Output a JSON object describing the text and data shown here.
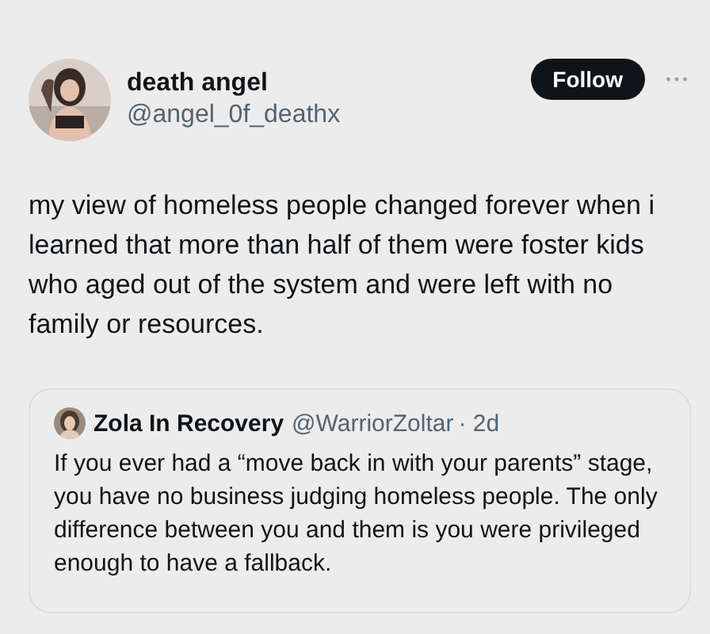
{
  "post": {
    "author": {
      "name": "death angel",
      "handle": "@angel_0f_deathx"
    },
    "follow_button": "Follow",
    "text": "my view of homeless people changed forever when i learned that more than half of them were foster kids who aged out of the system and were left with no family or resources.",
    "quoted_post": {
      "author": {
        "name": "Zola In Recovery",
        "handle": "@WarriorZoltar"
      },
      "time": "· 2d",
      "text": "If you ever had a “move back in with your parents” stage, you have no business judging homeless people. The only difference between you and them is you were privileged enough to have a fallback."
    }
  }
}
